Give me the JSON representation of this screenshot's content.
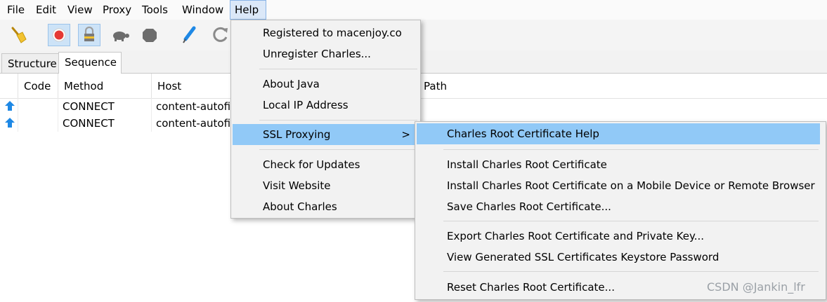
{
  "menubar": {
    "items": [
      "File",
      "Edit",
      "View",
      "Proxy",
      "Tools",
      "Window",
      "Help"
    ],
    "active": "Help"
  },
  "toolbar": {
    "buttons": [
      "broom-icon",
      "record-icon",
      "ssl-lock-icon",
      "turtle-icon",
      "stop-icon",
      "pen-icon",
      "refresh-icon"
    ]
  },
  "tabs": [
    "Structure",
    "Sequence"
  ],
  "table": {
    "columns": [
      "Code",
      "Method",
      "Host",
      "Path"
    ],
    "rows": [
      {
        "code": "",
        "method": "CONNECT",
        "host": "content-autofi"
      },
      {
        "code": "",
        "method": "CONNECT",
        "host": "content-autofi"
      }
    ]
  },
  "help_menu": {
    "items": [
      "Registered to macenjoy.co",
      "Unregister Charles...",
      "About Java",
      "Local IP Address",
      "SSL Proxying",
      "Check for Updates",
      "Visit Website",
      "About Charles"
    ],
    "submenu_arrow": ">"
  },
  "ssl_submenu": {
    "items": [
      "Charles Root Certificate Help",
      "Install Charles Root Certificate",
      "Install Charles Root Certificate on a Mobile Device or Remote Browser",
      "Save Charles Root Certificate...",
      "Export Charles Root Certificate and Private Key...",
      "View Generated SSL Certificates Keystore Password",
      "Reset Charles Root Certificate..."
    ]
  },
  "watermark": "CSDN @Jankin_lfr",
  "colors": {
    "highlight": "#91c9f7",
    "record": "#e53935",
    "arrow": "#1e88e5"
  }
}
